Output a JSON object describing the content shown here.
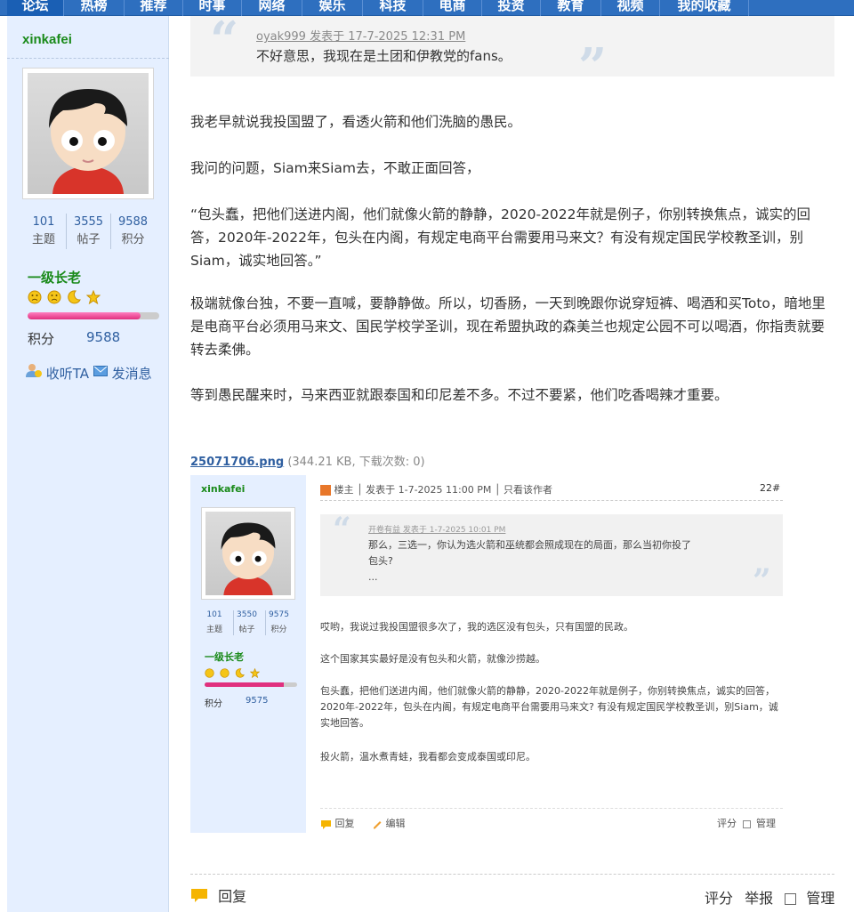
{
  "nav": {
    "items": [
      "论坛",
      "热榜",
      "推荐",
      "时事",
      "网络",
      "娱乐",
      "科技",
      "电商",
      "投资",
      "教育",
      "视频",
      "我的收藏"
    ]
  },
  "user": {
    "name": "xinkafei",
    "stats": [
      {
        "value": "101",
        "label": "主题"
      },
      {
        "value": "3555",
        "label": "帖子"
      },
      {
        "value": "9588",
        "label": "积分"
      }
    ],
    "rank": "一级长老",
    "points_label": "积分",
    "points_value": "9588",
    "level_progress_pct": 86,
    "follow_label": "收听TA",
    "message_label": "发消息"
  },
  "quote": {
    "author_line": "oyak999 发表于 17-7-2025 12:31 PM",
    "text": "不好意思，我现在是土团和伊教党的fans。"
  },
  "post": {
    "paragraphs": [
      "我老早就说我投国盟了，看透火箭和他们洗脑的愚民。",
      "我问的问题，Siam来Siam去，不敢正面回答，",
      "“包头蠢，把他们送进内阁，他们就像火箭的静静，2020-2022年就是例子，你别转换焦点，诚实的回答，2020年-2022年，包头在内阁，有规定电商平台需要用马来文？有没有规定国民学校教圣训，别Siam，诚实地回答。”",
      "极端就像台独，不要一直喊，要静静做。所以，切香肠，一天到晚跟你说穿短裤、喝酒和买Toto，暗地里是电商平台必须用马来文、国民学校学圣训，现在希盟执政的森美兰也规定公园不可以喝酒，你指责就要转去柔佛。",
      "等到愚民醒来时，马来西亚就跟泰国和印尼差不多。不过不要紧，他们吃香喝辣才重要。"
    ]
  },
  "attachment": {
    "filename": "25071706.png",
    "meta": "(344.21 KB, 下载次数: 0)"
  },
  "screenshot": {
    "user": {
      "name": "xinkafei",
      "stats": [
        {
          "value": "101",
          "label": "主题"
        },
        {
          "value": "3550",
          "label": "帖子"
        },
        {
          "value": "9575",
          "label": "积分"
        }
      ],
      "rank": "一级长老",
      "points_label": "积分",
      "points_value": "9575",
      "level_progress_pct": 86
    },
    "header": "楼主 │ 发表于 1-7-2025 11:00 PM │ 只看该作者",
    "floor": "22#",
    "quote": {
      "author_line": "开卷有益 发表于 1-7-2025 10:01 PM",
      "lines": [
        "那么，三选一，你认为选火箭和巫统都会照成现在的局面，那么当初你投了",
        "包头?",
        "..."
      ]
    },
    "paragraphs": [
      "哎哟，我说过我投国盟很多次了，我的选区没有包头，只有国盟的民政。",
      "这个国家其实最好是没有包头和火箭，就像沙捞越。",
      "包头蠢，把他们送进内阁，他们就像火箭的静静，2020-2022年就是例子，你别转换焦点，诚实的回答，2020年-2022年，包头在内阁，有规定电商平台需要用马来文? 有没有规定国民学校教圣训，别Siam，诚实地回答。",
      "投火箭，温水煮青蛙，我看都会变成泰国或印尼。"
    ],
    "footer": {
      "reply": "回复",
      "edit": "编辑",
      "rate": "评分",
      "manage": "管理"
    }
  },
  "footer": {
    "reply": "回复",
    "rate": "评分",
    "report": "举报",
    "manage": "管理"
  },
  "colors": {
    "nav_bg": "#2e6fbf",
    "sidebar_bg": "#e5efff",
    "name_green": "#1a8a1a",
    "link_blue": "#2f5fa0"
  }
}
